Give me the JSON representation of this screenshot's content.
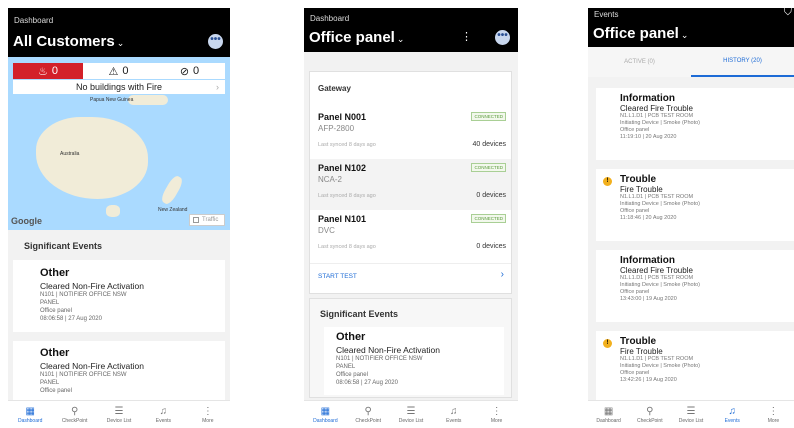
{
  "screen1": {
    "breadcrumb": "Dashboard",
    "title": "All Customers",
    "chevron": "⌄",
    "avatar": "•••",
    "fire_count": "0",
    "trouble_count": "0",
    "disabled_count": "0",
    "no_buildings": "No buildings with Fire",
    "map_labels": {
      "papua": "Papua New Guinea",
      "australia": "Australia",
      "nz": "New Zealand"
    },
    "google": "Google",
    "toggle": "Traffic",
    "section_title": "Significant Events",
    "events": [
      {
        "head": "Other",
        "sub": "Cleared Non-Fire Activation",
        "line1": "N101 | NOTIFIER OFFICE NSW",
        "line2": "PANEL",
        "line3": "Office panel",
        "line4": "08:06:58 | 27 Aug 2020"
      },
      {
        "head": "Other",
        "sub": "Cleared Non-Fire Activation",
        "line1": "N101 | NOTIFIER OFFICE NSW",
        "line2": "PANEL",
        "line3": "Office panel"
      }
    ]
  },
  "screen2": {
    "breadcrumb": "Dashboard",
    "title": "Office panel",
    "chevron": "⌄",
    "kebab": "⋮",
    "avatar": "•••",
    "gateway_title": "Gateway",
    "panels": [
      {
        "name": "Panel N001",
        "model": "AFP-2800",
        "sync": "Last synced 8 days ago",
        "devices": "40 devices",
        "status": "CONNECTED"
      },
      {
        "name": "Panel N102",
        "model": "NCA-2",
        "sync": "Last synced 8 days ago",
        "devices": "0 devices",
        "status": "CONNECTED"
      },
      {
        "name": "Panel N101",
        "model": "DVC",
        "sync": "Last synced 8 days ago",
        "devices": "0 devices",
        "status": "CONNECTED"
      }
    ],
    "start_test": "START TEST",
    "section_title": "Significant Events",
    "event": {
      "head": "Other",
      "sub": "Cleared Non-Fire Activation",
      "line1": "N101 | NOTIFIER OFFICE NSW",
      "line2": "PANEL",
      "line3": "Office panel",
      "line4": "08:06:58 | 27 Aug 2020"
    }
  },
  "screen3": {
    "breadcrumb": "Events",
    "title": "Office panel",
    "chevron": "⌄",
    "filter_icon": "⛉",
    "tab_active": "ACTIVE (0)",
    "tab_history": "HISTORY (20)",
    "warn_glyph": "!",
    "events": [
      {
        "head": "Information",
        "sub": "Cleared Fire Trouble",
        "l1": "N1.L1.D1 | PCB TEST ROOM",
        "l2": "Initiating Device | Smoke (Photo)",
        "l3": "Office panel",
        "l4": "11:19:10 | 20 Aug 2020",
        "warn": false
      },
      {
        "head": "Trouble",
        "sub": "Fire Trouble",
        "l1": "N1.L1.D1 | PCB TEST ROOM",
        "l2": "Initiating Device | Smoke (Photo)",
        "l3": "Office panel",
        "l4": "11:18:46 | 20 Aug 2020",
        "warn": true
      },
      {
        "head": "Information",
        "sub": "Cleared Fire Trouble",
        "l1": "N1.L1.D1 | PCB TEST ROOM",
        "l2": "Initiating Device | Smoke (Photo)",
        "l3": "Office panel",
        "l4": "13:43:00 | 19 Aug 2020",
        "warn": false
      },
      {
        "head": "Trouble",
        "sub": "Fire Trouble",
        "l1": "N1.L1.D1 | PCB TEST ROOM",
        "l2": "Initiating Device | Smoke (Photo)",
        "l3": "Office panel",
        "l4": "13:42:26 | 19 Aug 2020",
        "warn": true
      }
    ]
  },
  "nav": {
    "items": [
      {
        "label": "Dashboard",
        "icon": "▦"
      },
      {
        "label": "CheckPoint",
        "icon": "⚲"
      },
      {
        "label": "Device List",
        "icon": "☰"
      },
      {
        "label": "Events",
        "icon": "♫"
      },
      {
        "label": "More",
        "icon": "⋮"
      }
    ]
  },
  "colors": {
    "accent": "#1d6bd6",
    "fire": "#d32029",
    "warning": "#f2b01e",
    "connected": "#5b9b3c",
    "header": "#000000"
  }
}
